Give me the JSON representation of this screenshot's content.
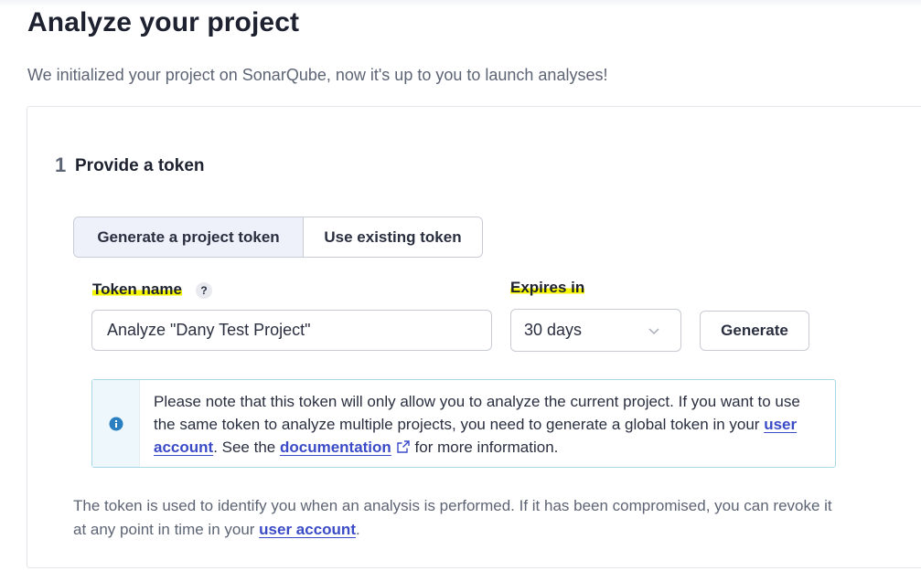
{
  "page": {
    "title": "Analyze your project",
    "subtitle": "We initialized your project on SonarQube, now it's up to you to launch analyses!"
  },
  "step": {
    "number": "1",
    "title": "Provide a token"
  },
  "token_mode": {
    "options": [
      "Generate a project token",
      "Use existing token"
    ],
    "selected": "Generate a project token"
  },
  "form": {
    "token_name_label": "Token name",
    "help_glyph": "?",
    "token_name_value": "Analyze \"Dany Test Project\"",
    "expires_label": "Expires in",
    "expires_value": "30 days",
    "generate_label": "Generate"
  },
  "info_box": {
    "text_1": "Please note that this token will only allow you to analyze the current project. If you want to use the same token to analyze multiple projects, you need to generate a global token in your ",
    "link_1": "user account",
    "text_2": ". See the ",
    "link_2": "documentation",
    "text_3": " for more information.",
    "icon": "info-icon"
  },
  "footnote": {
    "text_1": "The token is used to identify you when an analysis is performed. If it has been compromised, you can revoke it at any point in time in your ",
    "link": "user account",
    "text_2": "."
  },
  "colors": {
    "accent_link": "#3b4bc7",
    "highlight": "#f5f500",
    "info_border": "#a8d8e6",
    "info_icon": "#2a7fc1"
  }
}
